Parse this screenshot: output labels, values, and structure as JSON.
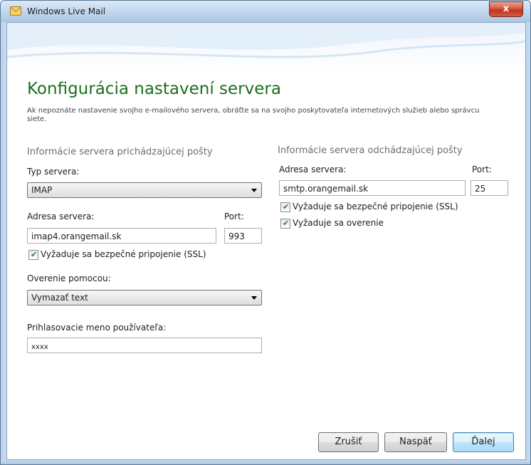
{
  "window": {
    "title": "Windows Live Mail",
    "close_glyph": "x",
    "icon": "mail-icon"
  },
  "page": {
    "heading": "Konfigurácia nastavení servera",
    "description": "Ak nepoznáte nastavenie svojho e-mailového servera, obráťte sa na svojho poskytovateľa internetových služieb alebo správcu siete."
  },
  "incoming": {
    "section_title": "Informácie servera prichádzajúcej pošty",
    "server_type_label": "Typ servera:",
    "server_type_value": "IMAP",
    "address_label": "Adresa servera:",
    "address_value": "imap4.orangemail.sk",
    "port_label": "Port:",
    "port_value": "993",
    "ssl_label": "Vyžaduje sa bezpečné pripojenie (SSL)",
    "ssl_checked": true,
    "auth_label": "Overenie pomocou:",
    "auth_value": "Vymazať text",
    "username_label": "Prihlasovacie meno používateľa:",
    "username_value": "xxxx"
  },
  "outgoing": {
    "section_title": "Informácie servera odchádzajúcej pošty",
    "address_label": "Adresa servera:",
    "address_value": "smtp.orangemail.sk",
    "port_label": "Port:",
    "port_value": "25",
    "ssl_label": "Vyžaduje sa bezpečné pripojenie (SSL)",
    "ssl_checked": true,
    "auth_required_label": "Vyžaduje sa overenie",
    "auth_required_checked": true
  },
  "buttons": {
    "cancel": "Zrušiť",
    "back": "Naspäť",
    "next": "Ďalej"
  },
  "colors": {
    "heading": "#1a6f1d",
    "check_mark": "#2a7f2a",
    "default_button_border": "#3c7fb1"
  }
}
